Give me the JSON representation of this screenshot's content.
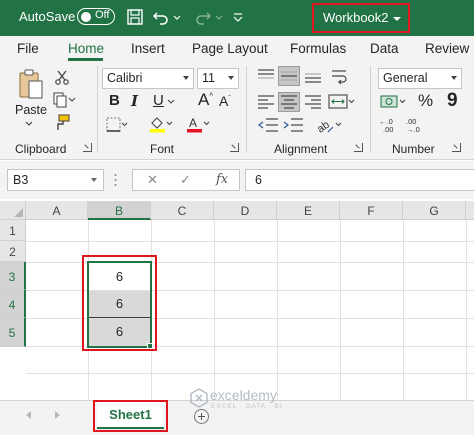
{
  "title_bar": {
    "autosave_label": "AutoSave",
    "autosave_state": "Off",
    "workbook_name": "Workbook2",
    "icons": [
      "save-icon",
      "undo-icon",
      "redo-icon",
      "customize-qat-icon"
    ]
  },
  "ribbon_tabs": [
    {
      "label": "File",
      "active": false
    },
    {
      "label": "Home",
      "active": true
    },
    {
      "label": "Insert",
      "active": false
    },
    {
      "label": "Page Layout",
      "active": false
    },
    {
      "label": "Formulas",
      "active": false
    },
    {
      "label": "Data",
      "active": false
    },
    {
      "label": "Review",
      "active": false
    }
  ],
  "ribbon": {
    "clipboard": {
      "label": "Clipboard",
      "paste_label": "Paste"
    },
    "font": {
      "label": "Font",
      "font_name": "Calibri",
      "font_size": "11"
    },
    "alignment": {
      "label": "Alignment"
    },
    "number": {
      "label": "Number",
      "format": "General"
    }
  },
  "formula_bar": {
    "name_box": "B3",
    "fx_label": "fx",
    "content": "6"
  },
  "grid": {
    "columns": [
      "A",
      "B",
      "C",
      "D",
      "E",
      "F",
      "G"
    ],
    "selected_column": "B",
    "rows": [
      "1",
      "2",
      "3",
      "4",
      "5"
    ],
    "cells": {
      "B3": "6",
      "B4": "6",
      "B5": "6"
    }
  },
  "sheet_tabs": [
    {
      "label": "Sheet1",
      "active": true
    }
  ],
  "watermark": {
    "name": "exceldemy",
    "tagline": "EXCEL · DATA · BI"
  },
  "colors": {
    "excel_green": "#217346",
    "highlight_red": "#e0161e",
    "ribbon_bg": "#f3f3f3",
    "font_color_swatch": "#e81123",
    "fill_color_swatch": "#ffff00"
  }
}
